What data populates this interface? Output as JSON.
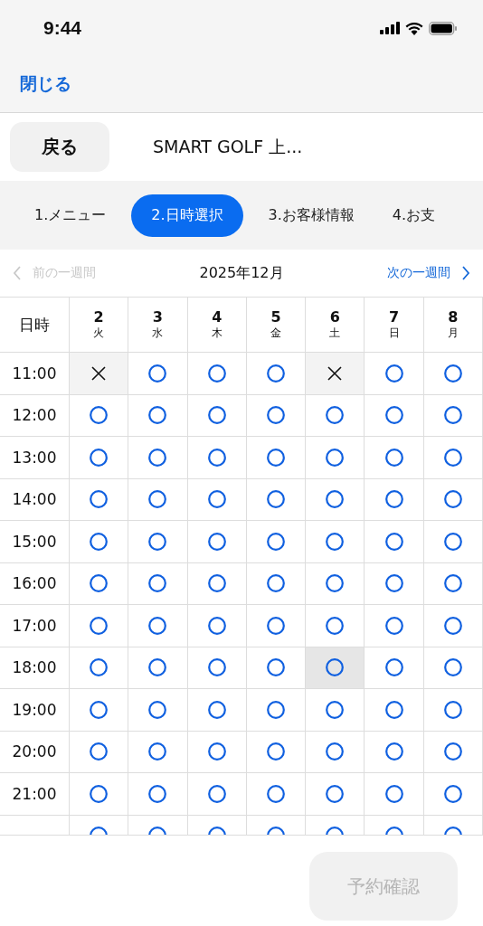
{
  "status_bar": {
    "time": "9:44"
  },
  "nav": {
    "close": "閉じる"
  },
  "header": {
    "back": "戻る",
    "title": "SMART GOLF 上..."
  },
  "steps": [
    {
      "label": "1.メニュー",
      "selected": false
    },
    {
      "label": "2.日時選択",
      "selected": true
    },
    {
      "label": "3.お客様情報",
      "selected": false
    },
    {
      "label": "4.お支",
      "selected": false
    }
  ],
  "week_nav": {
    "prev": {
      "label": "前の一週間",
      "disabled": true
    },
    "month": "2025年12月",
    "next": {
      "label": "次の一週間",
      "disabled": false
    }
  },
  "table": {
    "corner": "日時",
    "days": [
      {
        "date": "2",
        "weekday": "火"
      },
      {
        "date": "3",
        "weekday": "水"
      },
      {
        "date": "4",
        "weekday": "木"
      },
      {
        "date": "5",
        "weekday": "金"
      },
      {
        "date": "6",
        "weekday": "土"
      },
      {
        "date": "7",
        "weekday": "日"
      },
      {
        "date": "8",
        "weekday": "月"
      }
    ],
    "rows": [
      {
        "time": "11:00",
        "slots": [
          {
            "kind": "full",
            "selected": false
          },
          {
            "kind": "open",
            "selected": false
          },
          {
            "kind": "open",
            "selected": false
          },
          {
            "kind": "open",
            "selected": false
          },
          {
            "kind": "full",
            "selected": false
          },
          {
            "kind": "open",
            "selected": false
          },
          {
            "kind": "open",
            "selected": false
          }
        ]
      },
      {
        "time": "12:00",
        "slots": [
          {
            "kind": "open",
            "selected": false
          },
          {
            "kind": "open",
            "selected": false
          },
          {
            "kind": "open",
            "selected": false
          },
          {
            "kind": "open",
            "selected": false
          },
          {
            "kind": "open",
            "selected": false
          },
          {
            "kind": "open",
            "selected": false
          },
          {
            "kind": "open",
            "selected": false
          }
        ]
      },
      {
        "time": "13:00",
        "slots": [
          {
            "kind": "open",
            "selected": false
          },
          {
            "kind": "open",
            "selected": false
          },
          {
            "kind": "open",
            "selected": false
          },
          {
            "kind": "open",
            "selected": false
          },
          {
            "kind": "open",
            "selected": false
          },
          {
            "kind": "open",
            "selected": false
          },
          {
            "kind": "open",
            "selected": false
          }
        ]
      },
      {
        "time": "14:00",
        "slots": [
          {
            "kind": "open",
            "selected": false
          },
          {
            "kind": "open",
            "selected": false
          },
          {
            "kind": "open",
            "selected": false
          },
          {
            "kind": "open",
            "selected": false
          },
          {
            "kind": "open",
            "selected": false
          },
          {
            "kind": "open",
            "selected": false
          },
          {
            "kind": "open",
            "selected": false
          }
        ]
      },
      {
        "time": "15:00",
        "slots": [
          {
            "kind": "open",
            "selected": false
          },
          {
            "kind": "open",
            "selected": false
          },
          {
            "kind": "open",
            "selected": false
          },
          {
            "kind": "open",
            "selected": false
          },
          {
            "kind": "open",
            "selected": false
          },
          {
            "kind": "open",
            "selected": false
          },
          {
            "kind": "open",
            "selected": false
          }
        ]
      },
      {
        "time": "16:00",
        "slots": [
          {
            "kind": "open",
            "selected": false
          },
          {
            "kind": "open",
            "selected": false
          },
          {
            "kind": "open",
            "selected": false
          },
          {
            "kind": "open",
            "selected": false
          },
          {
            "kind": "open",
            "selected": false
          },
          {
            "kind": "open",
            "selected": false
          },
          {
            "kind": "open",
            "selected": false
          }
        ]
      },
      {
        "time": "17:00",
        "slots": [
          {
            "kind": "open",
            "selected": false
          },
          {
            "kind": "open",
            "selected": false
          },
          {
            "kind": "open",
            "selected": false
          },
          {
            "kind": "open",
            "selected": false
          },
          {
            "kind": "open",
            "selected": false
          },
          {
            "kind": "open",
            "selected": false
          },
          {
            "kind": "open",
            "selected": false
          }
        ]
      },
      {
        "time": "18:00",
        "slots": [
          {
            "kind": "open",
            "selected": false
          },
          {
            "kind": "open",
            "selected": false
          },
          {
            "kind": "open",
            "selected": false
          },
          {
            "kind": "open",
            "selected": false
          },
          {
            "kind": "open",
            "selected": true
          },
          {
            "kind": "open",
            "selected": false
          },
          {
            "kind": "open",
            "selected": false
          }
        ]
      },
      {
        "time": "19:00",
        "slots": [
          {
            "kind": "open",
            "selected": false
          },
          {
            "kind": "open",
            "selected": false
          },
          {
            "kind": "open",
            "selected": false
          },
          {
            "kind": "open",
            "selected": false
          },
          {
            "kind": "open",
            "selected": false
          },
          {
            "kind": "open",
            "selected": false
          },
          {
            "kind": "open",
            "selected": false
          }
        ]
      },
      {
        "time": "20:00",
        "slots": [
          {
            "kind": "open",
            "selected": false
          },
          {
            "kind": "open",
            "selected": false
          },
          {
            "kind": "open",
            "selected": false
          },
          {
            "kind": "open",
            "selected": false
          },
          {
            "kind": "open",
            "selected": false
          },
          {
            "kind": "open",
            "selected": false
          },
          {
            "kind": "open",
            "selected": false
          }
        ]
      },
      {
        "time": "21:00",
        "slots": [
          {
            "kind": "open",
            "selected": false
          },
          {
            "kind": "open",
            "selected": false
          },
          {
            "kind": "open",
            "selected": false
          },
          {
            "kind": "open",
            "selected": false
          },
          {
            "kind": "open",
            "selected": false
          },
          {
            "kind": "open",
            "selected": false
          },
          {
            "kind": "open",
            "selected": false
          }
        ]
      },
      {
        "slots": [
          {
            "kind": "open",
            "selected": false
          },
          {
            "kind": "open",
            "selected": false
          },
          {
            "kind": "open",
            "selected": false
          },
          {
            "kind": "open",
            "selected": false
          },
          {
            "kind": "open",
            "selected": false
          },
          {
            "kind": "open",
            "selected": false
          },
          {
            "kind": "open",
            "selected": false
          }
        ]
      }
    ]
  },
  "footer": {
    "confirm": {
      "label": "予約確認",
      "disabled": true
    }
  }
}
